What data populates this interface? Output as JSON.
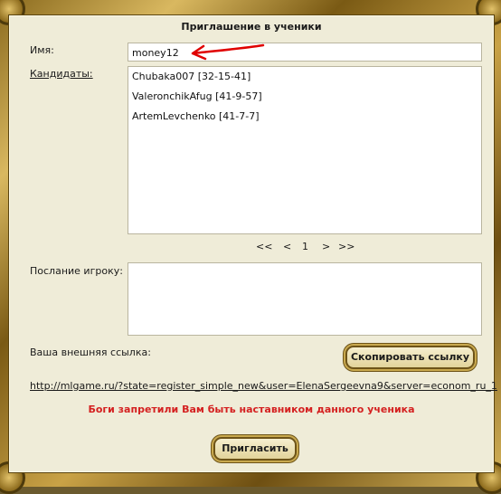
{
  "dialog": {
    "title": "Приглашение в ученики"
  },
  "name_field": {
    "label": "Имя:",
    "value": "money12"
  },
  "candidates": {
    "label": "Кандидаты:",
    "items": [
      "Chubaka007 [32-15-41]",
      "ValeronchikAfug [41-9-57]",
      "ArtemLevchenko [41-7-7]"
    ]
  },
  "pager": {
    "first": "<<",
    "prev": "<",
    "page": "1",
    "next": ">",
    "last": ">>"
  },
  "message": {
    "label": "Послание игроку:",
    "value": ""
  },
  "external_link": {
    "label": "Ваша внешняя ссылка:",
    "copy_button": "Скопировать ссылку",
    "url": "http://mlgame.ru/?state=register_simple_new&user=ElenaSergeevna9&server=econom_ru_1"
  },
  "error_text": "Боги запретили Вам быть наставником данного ученика",
  "invite_button": "Пригласить",
  "colors": {
    "error": "#d42020",
    "annotation_arrow": "#e00000"
  }
}
